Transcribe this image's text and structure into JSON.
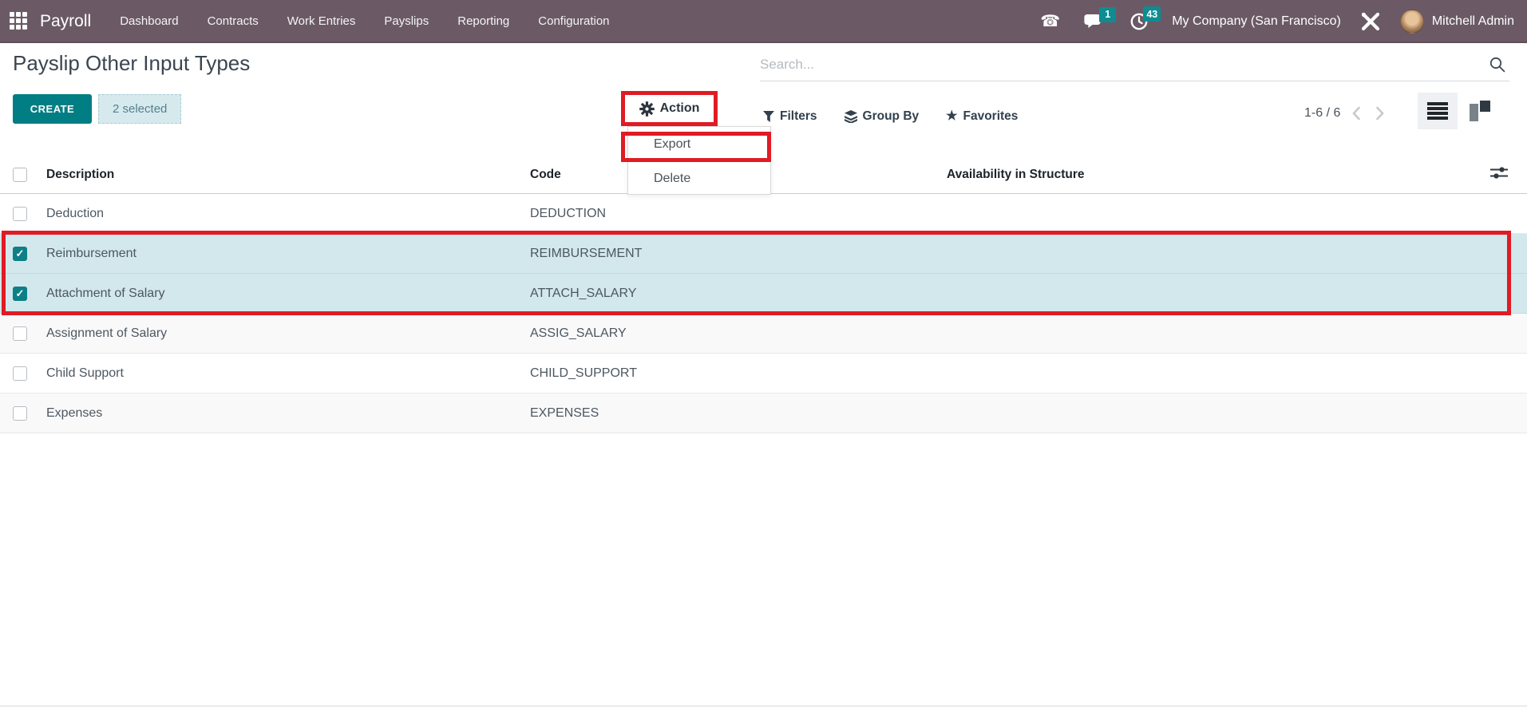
{
  "topbar": {
    "brand": "Payroll",
    "menu": [
      "Dashboard",
      "Contracts",
      "Work Entries",
      "Payslips",
      "Reporting",
      "Configuration"
    ],
    "chat_badge": "1",
    "activity_badge": "43",
    "company": "My Company (San Francisco)",
    "user": "Mitchell Admin"
  },
  "control_panel": {
    "title": "Payslip Other Input Types",
    "search_placeholder": "Search...",
    "create_label": "CREATE",
    "selected_count_label": "2 selected",
    "action_label": "Action",
    "filters_label": "Filters",
    "group_by_label": "Group By",
    "favorites_label": "Favorites",
    "pager_range": "1-6 / 6"
  },
  "action_menu": {
    "export_label": "Export",
    "delete_label": "Delete"
  },
  "table": {
    "columns": {
      "description": "Description",
      "code": "Code",
      "availability": "Availability in Structure"
    },
    "rows": [
      {
        "description": "Deduction",
        "code": "DEDUCTION",
        "availability": "",
        "selected": false
      },
      {
        "description": "Reimbursement",
        "code": "REIMBURSEMENT",
        "availability": "",
        "selected": true
      },
      {
        "description": "Attachment of Salary",
        "code": "ATTACH_SALARY",
        "availability": "",
        "selected": true
      },
      {
        "description": "Assignment of Salary",
        "code": "ASSIG_SALARY",
        "availability": "",
        "selected": false
      },
      {
        "description": "Child Support",
        "code": "CHILD_SUPPORT",
        "availability": "",
        "selected": false
      },
      {
        "description": "Expenses",
        "code": "EXPENSES",
        "availability": "",
        "selected": false
      }
    ]
  },
  "icons": {
    "phone": "☎",
    "star": "★",
    "check": "✓"
  },
  "colors": {
    "topbar_purple": "#6b5a66",
    "accent_teal": "#017e84",
    "badge_teal": "#0e8c91",
    "selected_row_teal": "#d2e8ec",
    "highlight_red": "#e01b24"
  }
}
